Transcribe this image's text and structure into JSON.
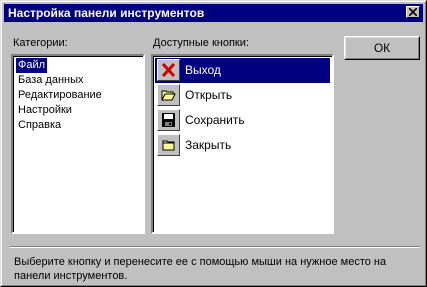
{
  "window": {
    "title": "Настройка панели инструментов",
    "close_icon": "close-icon"
  },
  "categories": {
    "label": "Категории:",
    "items": [
      {
        "label": "Файл",
        "selected": true
      },
      {
        "label": "База данных",
        "selected": false
      },
      {
        "label": "Редактирование",
        "selected": false
      },
      {
        "label": "Настройки",
        "selected": false
      },
      {
        "label": "Справка",
        "selected": false
      }
    ]
  },
  "buttons": {
    "label": "Доступные кнопки:",
    "items": [
      {
        "label": "Выход",
        "icon": "exit-x-icon",
        "selected": true
      },
      {
        "label": "Открыть",
        "icon": "open-folder-icon",
        "selected": false
      },
      {
        "label": "Сохранить",
        "icon": "save-disk-icon",
        "selected": false
      },
      {
        "label": "Закрыть",
        "icon": "close-folder-icon",
        "selected": false
      }
    ]
  },
  "ok_label": "ОК",
  "description": "Выберите кнопку и перенесите ее с помощью мыши на нужное место на панели инструментов.",
  "colors": {
    "face": "#c0c0c0",
    "selection": "#000080",
    "title_bar": "#000080",
    "exit_icon": "#cc0000",
    "folder": "#ffff99"
  }
}
